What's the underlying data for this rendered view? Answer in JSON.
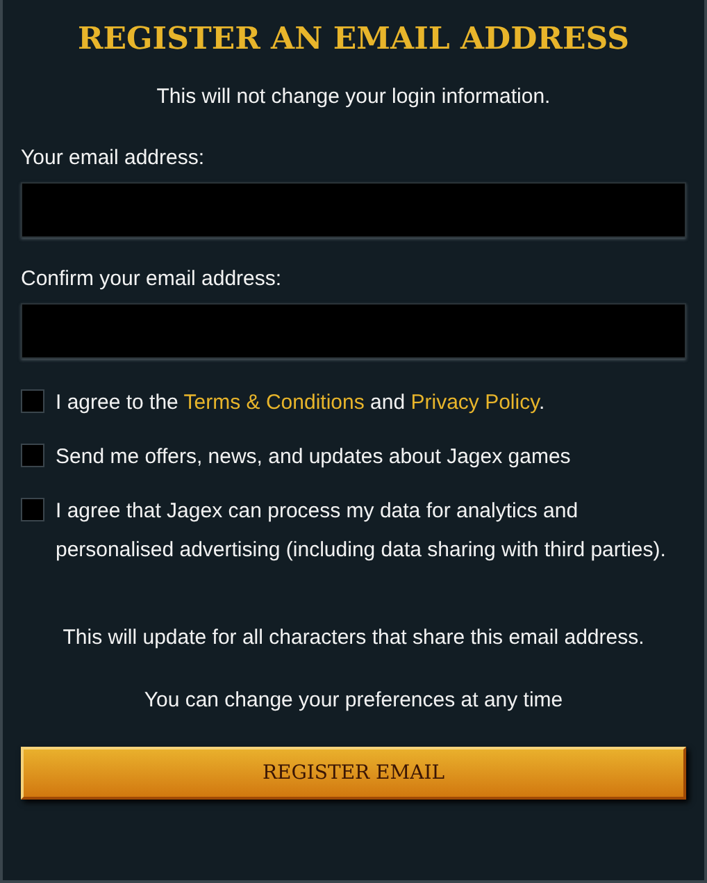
{
  "title": "REGISTER AN EMAIL ADDRESS",
  "subtitle": "This will not change your login information.",
  "fields": [
    {
      "label": "Your email address:"
    },
    {
      "label": "Confirm your email address:"
    }
  ],
  "checkboxes": [
    {
      "checked": false,
      "parts": [
        {
          "kind": "text",
          "text": "I agree to the "
        },
        {
          "kind": "link",
          "text": "Terms & Conditions"
        },
        {
          "kind": "text",
          "text": " and "
        },
        {
          "kind": "link",
          "text": "Privacy Policy"
        },
        {
          "kind": "text",
          "text": "."
        }
      ]
    },
    {
      "checked": false,
      "parts": [
        {
          "kind": "text",
          "text": "Send me offers, news, and updates about Jagex games"
        }
      ]
    },
    {
      "checked": false,
      "parts": [
        {
          "kind": "text",
          "text": "I agree that Jagex can process my data for analytics and personalised advertising (including data sharing with third parties)."
        }
      ]
    }
  ],
  "notes": [
    "This will update for all characters that share this email address.",
    "You can change your preferences at any time"
  ],
  "button": "REGISTER EMAIL"
}
